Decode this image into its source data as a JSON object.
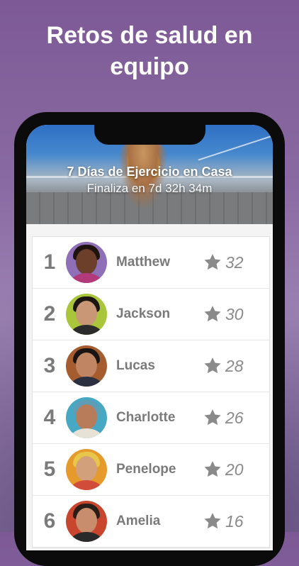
{
  "headline": "Retos de salud en equipo",
  "challenge": {
    "title": "7 Días de Ejercicio en Casa",
    "subtitle": "Finaliza en 7d 32h 34m"
  },
  "leaderboard": [
    {
      "rank": "1",
      "name": "Matthew",
      "score": "32",
      "bg": "#8e6fb8",
      "skin": "#6b3f2a",
      "hair": "#1e130e",
      "shirt": "#b23a7a"
    },
    {
      "rank": "2",
      "name": "Jackson",
      "score": "30",
      "bg": "#a9c63a",
      "skin": "#c99676",
      "hair": "#1b1411",
      "shirt": "#2b2b2b"
    },
    {
      "rank": "3",
      "name": "Lucas",
      "score": "28",
      "bg": "#a55c2f",
      "skin": "#c08563",
      "hair": "#1a1412",
      "shirt": "#2b3040"
    },
    {
      "rank": "4",
      "name": "Charlotte",
      "score": "26",
      "bg": "#47a8c4",
      "skin": "#b87c5a",
      "hair": "#5e9db5",
      "shirt": "#e7e2d6"
    },
    {
      "rank": "5",
      "name": "Penelope",
      "score": "20",
      "bg": "#e59a2b",
      "skin": "#d2a07a",
      "hair": "#e8c64a",
      "shirt": "#d24c3a"
    },
    {
      "rank": "6",
      "name": "Amelia",
      "score": "16",
      "bg": "#c8452e",
      "skin": "#c88d6c",
      "hair": "#2a1c17",
      "shirt": "#2a2a2a"
    }
  ],
  "colors": {
    "background": "#7d5a96",
    "star": "#8a8a8a",
    "text_muted": "#7a7a7a"
  },
  "icons": {
    "score_icon": "star-icon"
  }
}
